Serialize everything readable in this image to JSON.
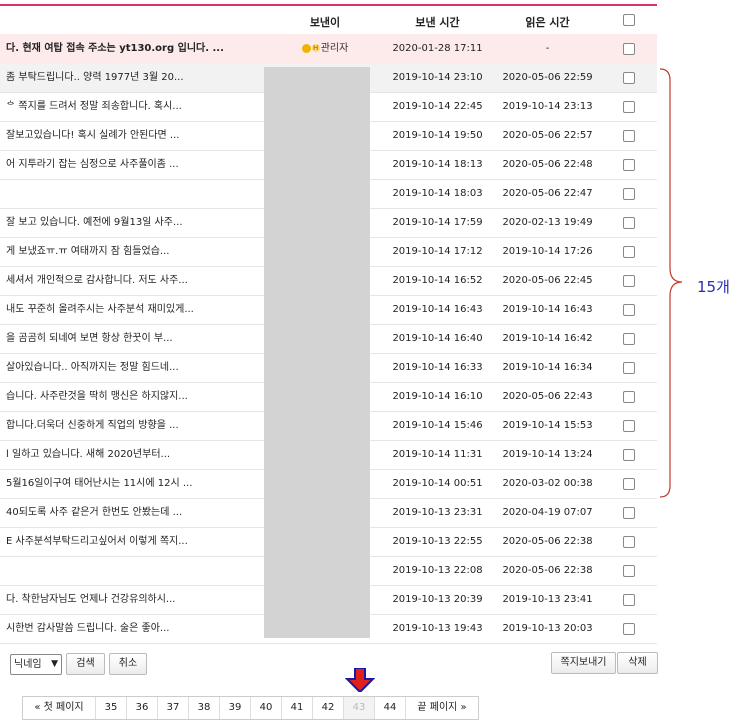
{
  "header": {
    "sender": "보낸이",
    "sent_time": "보낸 시간",
    "read_time": "읽은 시간"
  },
  "notice": {
    "title": "다. 현재 여탑 접속 주소는 yt130.org 입니다. ...",
    "sender": "관리자",
    "sent": "2020-01-28 17:11",
    "read": "-"
  },
  "rows": [
    {
      "title": "좀 부탁드립니다.. 양력 1977년 3월 20...",
      "sent": "2019-10-14 23:10",
      "read": "2020-05-06 22:59"
    },
    {
      "title": "ᅌ 쪽지를 드려서 정말 죄송합니다. 혹시...",
      "sent": "2019-10-14 22:45",
      "read": "2019-10-14 23:13"
    },
    {
      "title": "잘보고있습니다! 혹시 실례가 안된다면 ...",
      "sent": "2019-10-14 19:50",
      "read": "2020-05-06 22:57"
    },
    {
      "title": "어 지투라기 잡는 심정으로 사주풀이좀 ...",
      "sent": "2019-10-14 18:13",
      "read": "2020-05-06 22:48"
    },
    {
      "title": "",
      "sent": "2019-10-14 18:03",
      "read": "2020-05-06 22:47"
    },
    {
      "title": "잘 보고 있습니다. 예전에 9월13일 사주...",
      "sent": "2019-10-14 17:59",
      "read": "2020-02-13 19:49"
    },
    {
      "title": "게 보냈죠ㅠ.ㅠ 여태까지 잠 힘들었습...",
      "sent": "2019-10-14 17:12",
      "read": "2019-10-14 17:26"
    },
    {
      "title": "세셔서 개인적으로 감사합니다. 저도 사주...",
      "sent": "2019-10-14 16:52",
      "read": "2020-05-06 22:45"
    },
    {
      "title": "내도 꾸준히 올려주시는 사주분석 재미있게...",
      "sent": "2019-10-14 16:43",
      "read": "2019-10-14 16:43"
    },
    {
      "title": "을 곰곰히 되네여 보면 항상 한꿋이 부...",
      "sent": "2019-10-14 16:40",
      "read": "2019-10-14 16:42"
    },
    {
      "title": "살아있습니다.. 아직까지는 정말 힘드네...",
      "sent": "2019-10-14 16:33",
      "read": "2019-10-14 16:34"
    },
    {
      "title": "습니다. 사주란것을 딱히 맹신은 하지않지...",
      "sent": "2019-10-14 16:10",
      "read": "2020-05-06 22:43"
    },
    {
      "title": "합니다.더욱더 신중하게 직업의 방향을 ...",
      "sent": "2019-10-14 15:46",
      "read": "2019-10-14 15:53"
    },
    {
      "title": "l 일하고 있습니다. 새해 2020년부터...",
      "sent": "2019-10-14 11:31",
      "read": "2019-10-14 13:24"
    },
    {
      "title": "5월16일이구여 태어난시는 11시에 12시 ...",
      "sent": "2019-10-14 00:51",
      "read": "2020-03-02 00:38"
    },
    {
      "title": "40되도록 사주 같은거 한번도 안봤는데 ...",
      "sent": "2019-10-13 23:31",
      "read": "2020-04-19 07:07"
    },
    {
      "title": "E 사주분석부탁드리고싶어서 이렇게 쪽지...",
      "sent": "2019-10-13 22:55",
      "read": "2020-05-06 22:38"
    },
    {
      "title": "",
      "sent": "2019-10-13 22:08",
      "read": "2020-05-06 22:38"
    },
    {
      "title": "다. 착한남자님도 언제나 건강유의하시...",
      "sent": "2019-10-13 20:39",
      "read": "2019-10-13 23:41"
    },
    {
      "title": "시한번 감사말씀 드립니다. 술은 좋아...",
      "sent": "2019-10-13 19:43",
      "read": "2019-10-13 20:03"
    }
  ],
  "search": {
    "select_value": "닉네임",
    "search_label": "검색",
    "cancel_label": "취소"
  },
  "actions": {
    "send_label": "쪽지보내기",
    "delete_label": "삭제"
  },
  "pager": {
    "first": "« 첫 페이지",
    "pages": [
      "35",
      "36",
      "37",
      "38",
      "39",
      "40",
      "41",
      "42",
      "43",
      "44"
    ],
    "current": "43",
    "last": "끝 페이지 »"
  },
  "annotation": {
    "count": "15개",
    "color": "#2b2bb5",
    "brace_color": "#c0392b",
    "arrow_color": "#e0201c"
  }
}
